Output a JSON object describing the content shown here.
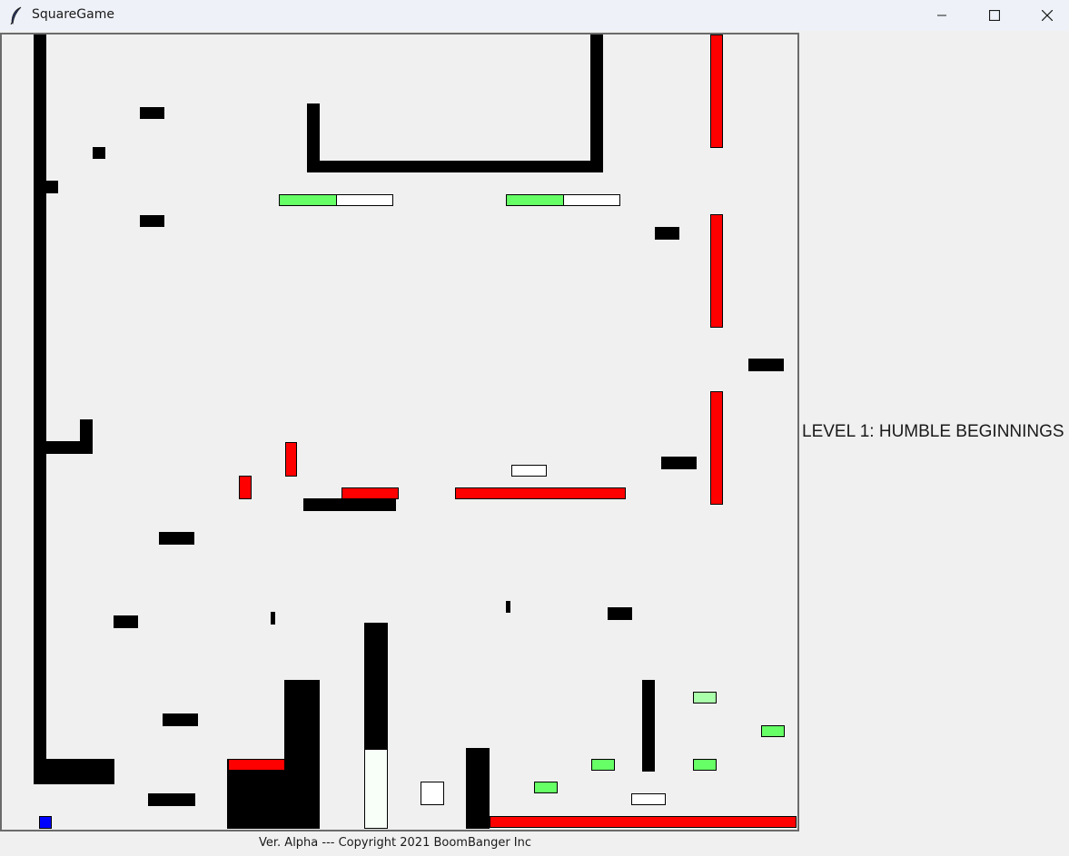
{
  "window": {
    "title": "SquareGame",
    "icon": "feather-icon",
    "controls": [
      "minimize-icon",
      "maximize-icon",
      "close-icon"
    ]
  },
  "game": {
    "level_label": "LEVEL 1: HUMBLE BEGINNINGS",
    "footer": "Ver. Alpha --- Copyright 2021 BoomBanger Inc",
    "colors": {
      "wall": "#000000",
      "hazard": "#ff0000",
      "goal": "#66ff66",
      "goal_light": "#aaffaa",
      "platform": "#ffffff",
      "player": "#0000ff",
      "background": "#f0f0f0"
    }
  }
}
